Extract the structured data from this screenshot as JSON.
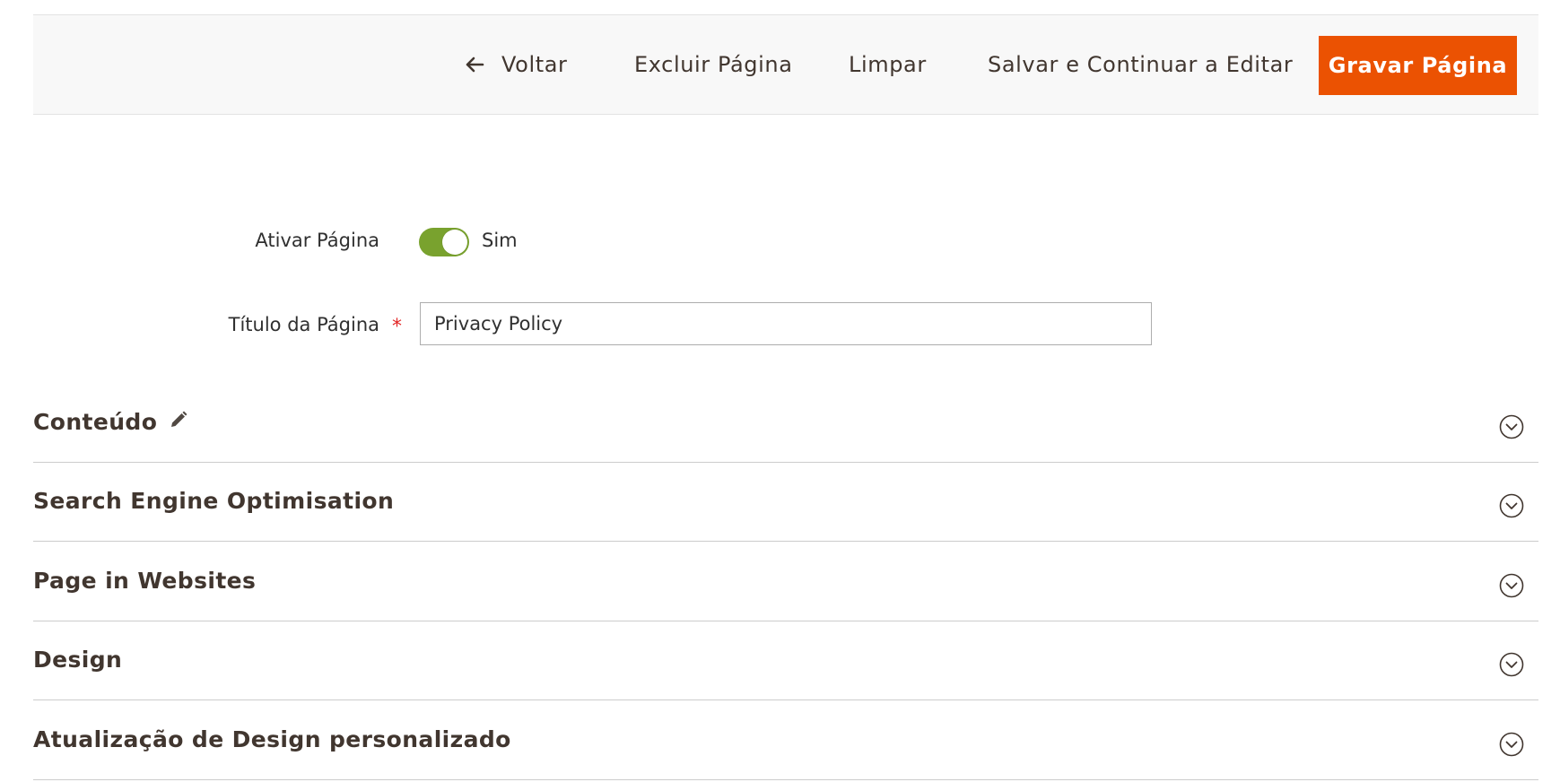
{
  "toolbar": {
    "back_label": "Voltar",
    "delete_label": "Excluir Página",
    "reset_label": "Limpar",
    "save_continue_label": "Salvar e Continuar a Editar",
    "save_label": "Gravar Página",
    "back_icon": "arrow-left-icon",
    "primary_color": "#eb5202"
  },
  "form": {
    "active": {
      "label": "Ativar Página",
      "value_text": "Sim",
      "enabled": true,
      "toggle_color": "#79a22e"
    },
    "title": {
      "label": "Título da Página",
      "required_mark": "*",
      "value": "Privacy Policy"
    }
  },
  "sections": [
    {
      "title": "Conteúdo",
      "icon": "pencil-icon",
      "chevron": "chevron-down-circle-icon"
    },
    {
      "title": "Search Engine Optimisation",
      "chevron": "chevron-down-circle-icon"
    },
    {
      "title": "Page in Websites",
      "chevron": "chevron-down-circle-icon"
    },
    {
      "title": "Design",
      "chevron": "chevron-down-circle-icon"
    },
    {
      "title": "Atualização de Design personalizado",
      "chevron": "chevron-down-circle-icon"
    }
  ]
}
